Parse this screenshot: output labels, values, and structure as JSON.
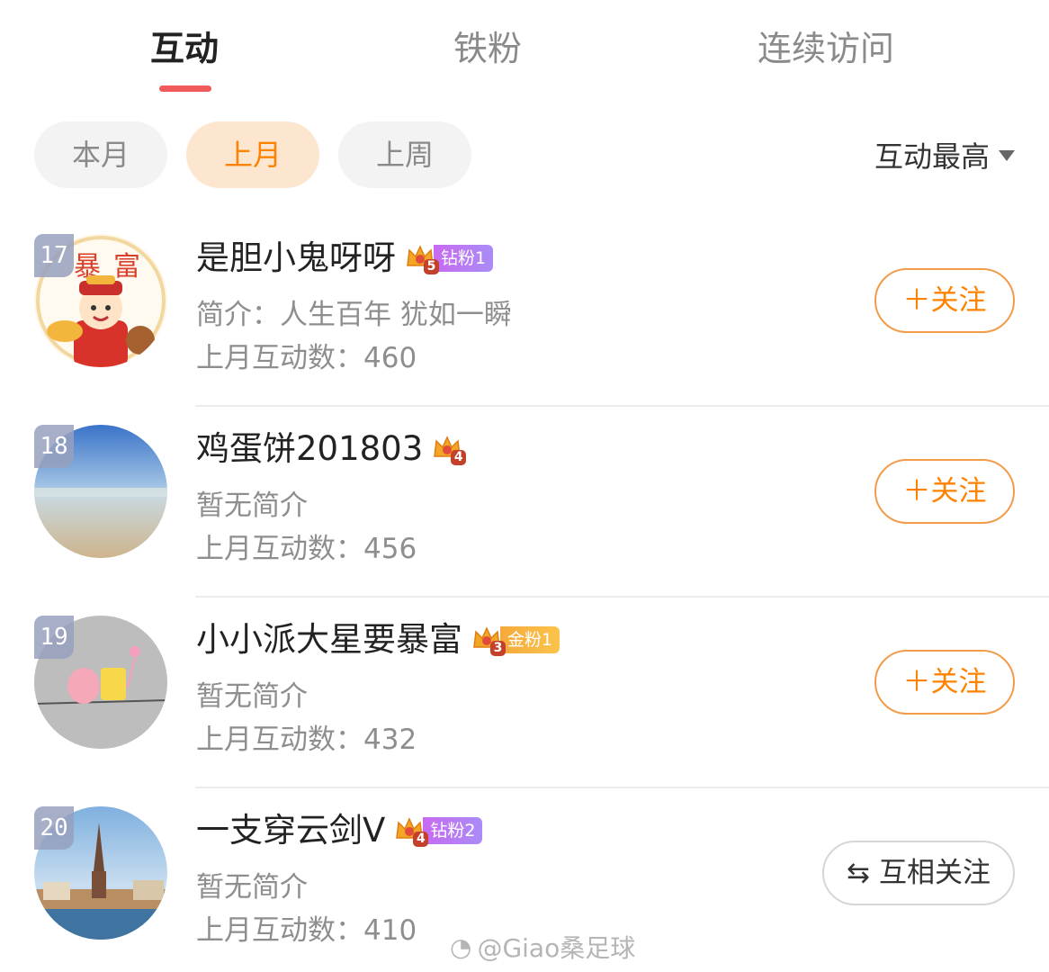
{
  "tabs": [
    {
      "label": "互动",
      "active": true
    },
    {
      "label": "铁粉",
      "active": false
    },
    {
      "label": "连续访问",
      "active": false
    }
  ],
  "filters": [
    {
      "label": "本月",
      "active": false
    },
    {
      "label": "上月",
      "active": true
    },
    {
      "label": "上周",
      "active": false
    }
  ],
  "sort": {
    "label": "互动最高"
  },
  "colors": {
    "accent": "#ff8200",
    "tab_underline": "#f05a5a",
    "active_filter_bg": "#fde6d0"
  },
  "rows": [
    {
      "rank": "17",
      "name": "是胆小鬼呀呀",
      "level": "5",
      "fan_label": "钻粉1",
      "fan_type": "diamond",
      "bio": "简介：人生百年 犹如一瞬",
      "count": "上月互动数：460",
      "action": "＋关注",
      "action_type": "follow",
      "avatar": "cartoon-fortune-god"
    },
    {
      "rank": "18",
      "name": "鸡蛋饼201803",
      "level": "4",
      "fan_label": "",
      "fan_type": "none",
      "bio": "暂无简介",
      "count": "上月互动数：456",
      "action": "＋关注",
      "action_type": "follow",
      "avatar": "beach-photo"
    },
    {
      "rank": "19",
      "name": "小小派大星要暴富",
      "level": "3",
      "fan_label": "金粉1",
      "fan_type": "gold",
      "bio": "暂无简介",
      "count": "上月互动数：432",
      "action": "＋关注",
      "action_type": "follow",
      "avatar": "patrick-spongebob"
    },
    {
      "rank": "20",
      "name": "一支穿云剑V",
      "level": "4",
      "fan_label": "钻粉2",
      "fan_type": "diamond",
      "bio": "暂无简介",
      "count": "上月互动数：410",
      "action": "互相关注",
      "action_type": "mutual",
      "avatar": "city-church-photo"
    }
  ],
  "watermark": {
    "text": "@Giao桑足球"
  }
}
